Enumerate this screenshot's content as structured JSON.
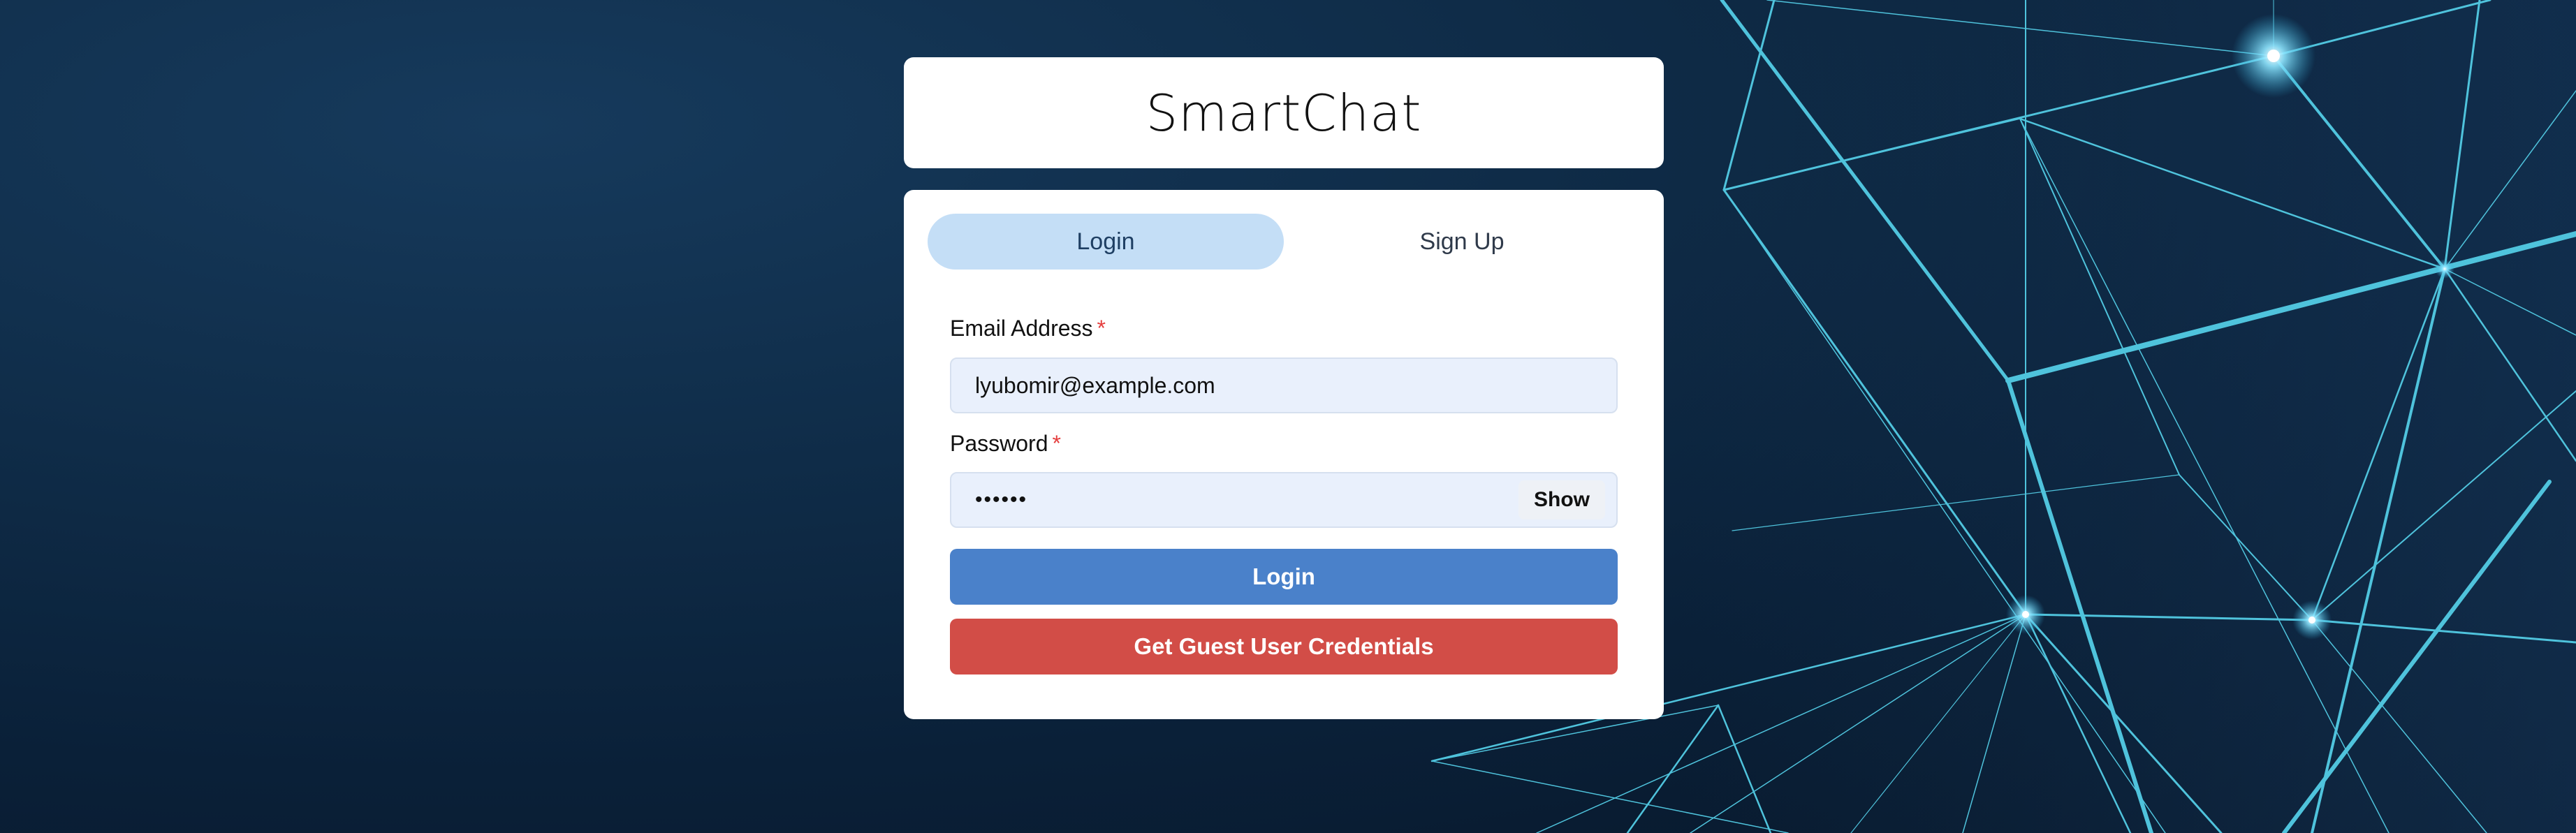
{
  "app": {
    "title": "SmartChat"
  },
  "tabs": [
    {
      "label": "Login",
      "active": true
    },
    {
      "label": "Sign Up",
      "active": false
    }
  ],
  "form": {
    "email": {
      "label": "Email Address",
      "required_marker": "*",
      "value": "lyubomir@example.com"
    },
    "password": {
      "label": "Password",
      "required_marker": "*",
      "masked_value": "••••••",
      "toggle_label": "Show"
    },
    "login_button": "Login",
    "guest_button": "Get Guest User Credentials"
  },
  "colors": {
    "active_tab_bg": "#c4def6",
    "login_button": "#4a81ca",
    "guest_button": "#d24d47",
    "input_bg": "#e9f0fc",
    "required": "#e53e3e",
    "background": "#0f2c48",
    "network_lines": "#4fc3dc"
  }
}
